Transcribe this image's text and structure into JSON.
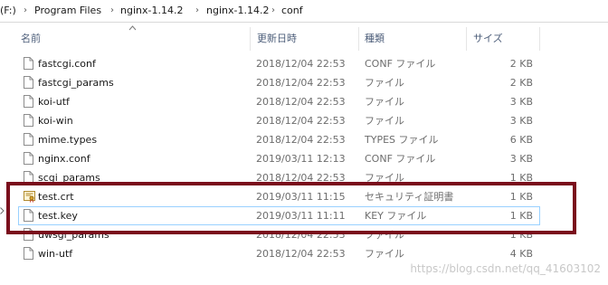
{
  "address": {
    "prefix": "(F:)",
    "crumbs": [
      "Program Files",
      "nginx-1.14.2",
      "nginx-1.14.2",
      "conf"
    ],
    "separator": "›"
  },
  "columns": {
    "name": "名前",
    "date": "更新日時",
    "type": "種類",
    "size": "サイズ"
  },
  "files": [
    {
      "name": "fastcgi.conf",
      "date": "2018/12/04 22:53",
      "type": "CONF ファイル",
      "size": "2 KB",
      "icon": "file-icon"
    },
    {
      "name": "fastcgi_params",
      "date": "2018/12/04 22:53",
      "type": "ファイル",
      "size": "2 KB",
      "icon": "file-icon"
    },
    {
      "name": "koi-utf",
      "date": "2018/12/04 22:53",
      "type": "ファイル",
      "size": "3 KB",
      "icon": "file-icon"
    },
    {
      "name": "koi-win",
      "date": "2018/12/04 22:53",
      "type": "ファイル",
      "size": "3 KB",
      "icon": "file-icon"
    },
    {
      "name": "mime.types",
      "date": "2018/12/04 22:53",
      "type": "TYPES ファイル",
      "size": "6 KB",
      "icon": "file-icon"
    },
    {
      "name": "nginx.conf",
      "date": "2019/03/11 12:13",
      "type": "CONF ファイル",
      "size": "3 KB",
      "icon": "file-icon"
    },
    {
      "name": "scgi_params",
      "date": "2018/12/04 22:53",
      "type": "ファイル",
      "size": "1 KB",
      "icon": "file-icon"
    },
    {
      "name": "test.crt",
      "date": "2019/03/11 11:15",
      "type": "セキュリティ証明書",
      "size": "1 KB",
      "icon": "certificate-icon"
    },
    {
      "name": "test.key",
      "date": "2019/03/11 11:11",
      "type": "KEY ファイル",
      "size": "1 KB",
      "icon": "file-icon"
    },
    {
      "name": "uwsgi_params",
      "date": "2018/12/04 22:53",
      "type": "ファイル",
      "size": "1 KB",
      "icon": "file-icon"
    },
    {
      "name": "win-utf",
      "date": "2018/12/04 22:53",
      "type": "ファイル",
      "size": "4 KB",
      "icon": "file-icon"
    }
  ],
  "selected_file": "test.key",
  "watermark": "https://blog.csdn.net/qq_41603102",
  "colors": {
    "highlight_border": "#7a0d1c",
    "selection_border": "#99d1ff",
    "header_text": "#4d5e7a",
    "secondary_text": "#6d6d6d"
  }
}
